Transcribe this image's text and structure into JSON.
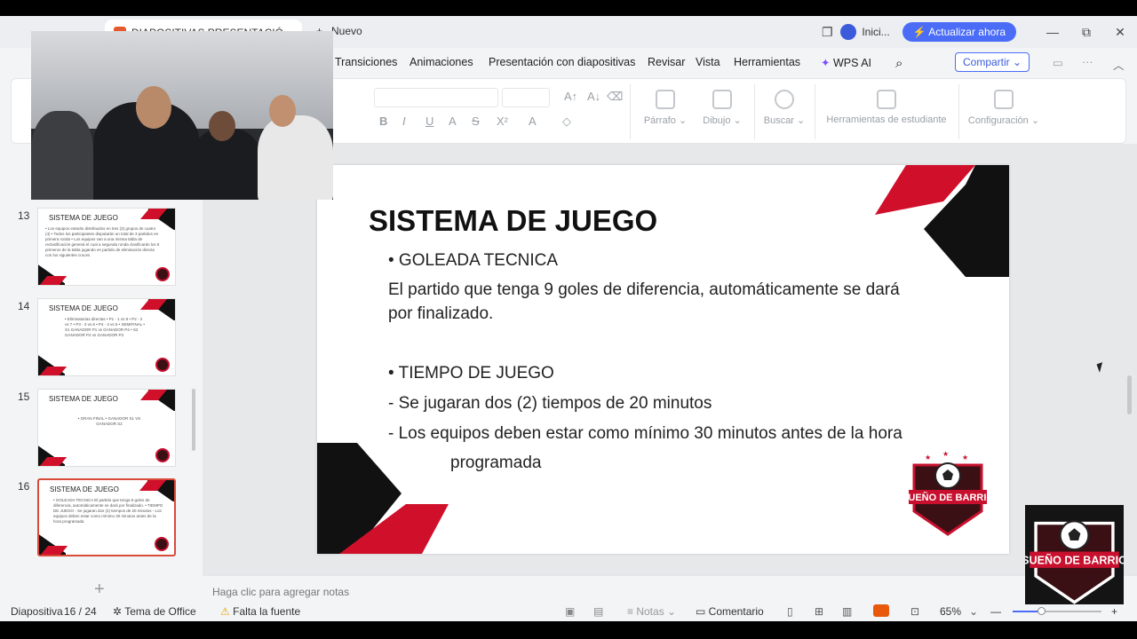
{
  "titlebar": {
    "doc_tab": "DIAPOSITIVAS PRESENTACIÓ",
    "new_tab": "Nuevo",
    "login": "Inici...",
    "update_button": "Actualizar ahora"
  },
  "menu": {
    "items": [
      "Transiciones",
      "Animaciones",
      "Presentación con diapositivas",
      "Revisar",
      "Vista",
      "Herramientas"
    ],
    "wps_ai": "WPS AI",
    "share": "Compartir"
  },
  "toolbar": {
    "groups": [
      "Párrafo",
      "Dibujo",
      "Buscar",
      "Herramientas de estudiante",
      "Configuración"
    ]
  },
  "slides": [
    {
      "number": "13",
      "title": "SISTEMA DE JUEGO",
      "body": "• Los equipos estarán distribuidos en tres (3) grupos de cuatro (4) • Todos los participantes disputarán un total de 3 partidos en primera ronda • Los equipos van a una misma tabla de reclasificación general el cual a segunda ronda clasificarán los 8 primeros de la tabla jugando en partido de eliminación directa con los siguientes cruces"
    },
    {
      "number": "14",
      "title": "SISTEMA DE JUEGO",
      "body": "• Eliminatorias directas • P1 - 1 vs 8 • P2 - 2 vs 7 • P3 - 3 vs 6 • P4 - 4 vs 5 • SEMIFINAL • S1 GANADOR P1 vs GANADOR P4 • S2 GANADOR P2 vs GANADOR P3"
    },
    {
      "number": "15",
      "title": "SISTEMA DE JUEGO",
      "body": "• GRAN FINAL • GANADOR S1 VS GANADOR S2"
    },
    {
      "number": "16",
      "title": "SISTEMA DE JUEGO",
      "body": "• GOLEADA TECNICA El partido que tenga 9 goles de diferencia, automáticamente se dará por finalizado. • TIEMPO DE JUEGO - Se jugaran dos (2) tiempos de 20 minutos - Los equipos deben estar como mínimo 30 minutos antes de la hora programada"
    }
  ],
  "current_slide": {
    "title": "SISTEMA DE JUEGO",
    "bullet1": "• GOLEADA TECNICA",
    "text1a": "El partido que tenga 9 goles de diferencia, automáticamente se dará",
    "text1b": "por finalizado.",
    "bullet2": "• TIEMPO DE JUEGO",
    "text2": "- Se jugaran dos (2) tiempos de 20 minutos",
    "text3a": "- Los equipos deben estar como mínimo 30 minutos antes de la hora",
    "text3b": "programada",
    "logo_text": "SUEÑO DE BARRIO"
  },
  "notes_placeholder": "Haga clic para agregar notas",
  "status": {
    "slide_label": "Diapositiva",
    "slide_count": "16 / 24",
    "theme": "Tema de Office",
    "font_warning": "Falta la fuente",
    "notes": "Notas",
    "comment": "Comentario",
    "zoom": "65%"
  },
  "colors": {
    "accent": "#4a6cf7",
    "brand_red": "#d0102a",
    "selected_border": "#d94a3a"
  }
}
